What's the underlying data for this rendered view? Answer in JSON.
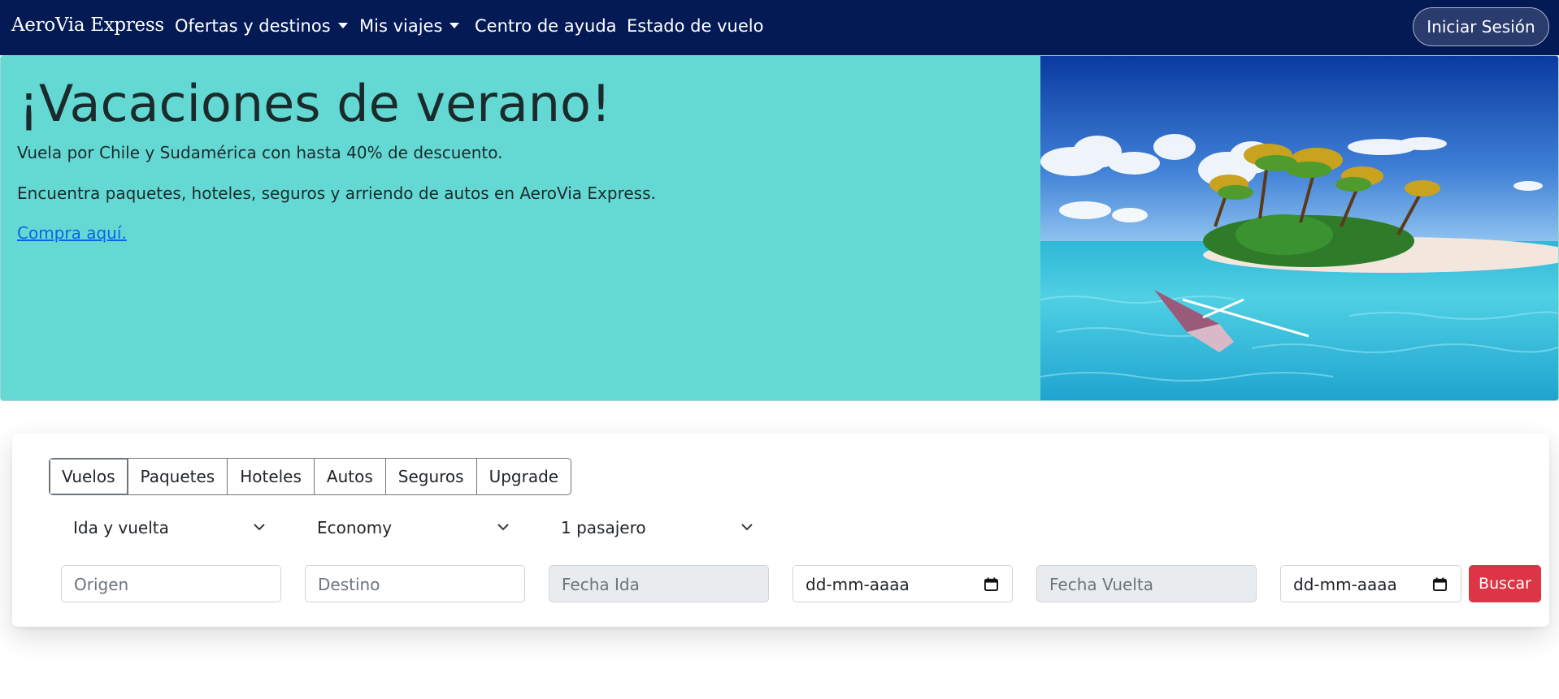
{
  "navbar": {
    "brand": "AeroVia Express",
    "links": [
      {
        "label": "Ofertas y destinos",
        "dropdown": true
      },
      {
        "label": "Mis viajes",
        "dropdown": true
      },
      {
        "label": "Centro de ayuda",
        "dropdown": false
      },
      {
        "label": "Estado de vuelo",
        "dropdown": false
      }
    ],
    "login_label": "Iniciar Sesión"
  },
  "hero": {
    "title": "¡Vacaciones de verano!",
    "line1": "Vuela por Chile y Sudamérica con hasta 40% de descuento.",
    "line2": "Encuentra paquetes, hoteles, seguros y arriendo de autos en AeroVia Express.",
    "link": "Compra aquí.",
    "background_color": "#64d9d4"
  },
  "search": {
    "tabs": [
      "Vuelos",
      "Paquetes",
      "Hoteles",
      "Autos",
      "Seguros",
      "Upgrade"
    ],
    "active_tab": "Vuelos",
    "trip_type": "Ida y vuelta",
    "cabin": "Economy",
    "passengers": "1 pasajero",
    "origin_placeholder": "Origen",
    "destination_placeholder": "Destino",
    "depart_label": "Fecha Ida",
    "depart_date_placeholder": "dd-mm-aaaa",
    "return_label": "Fecha Vuelta",
    "return_date_placeholder": "dd-mm-aaaa",
    "search_button": "Buscar"
  },
  "colors": {
    "navbar": "#031a55",
    "search_button": "#dc3545",
    "link": "#0d63e8"
  }
}
